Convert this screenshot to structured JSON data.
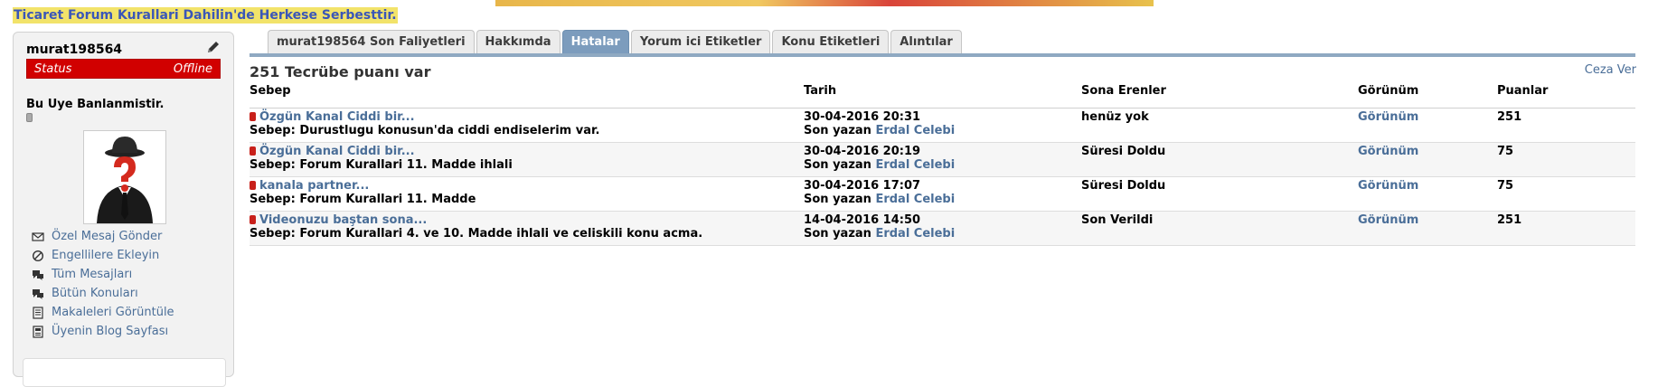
{
  "banner": {
    "notice": "Ticaret Forum Kurallari Dahilin'de Herkese Serbesttir."
  },
  "sidebar": {
    "username": "murat198564",
    "status_label": "Status",
    "status_value": "Offline",
    "banned_text": "Bu Uye Banlanmistir.",
    "links": [
      {
        "label": "Özel Mesaj Gönder",
        "icon": "envelope-icon"
      },
      {
        "label": "Engellilere Ekleyin",
        "icon": "block-icon"
      },
      {
        "label": "Tüm Mesajları",
        "icon": "chat-bubbles-icon"
      },
      {
        "label": "Bütün Konuları",
        "icon": "chat-bubbles-icon"
      },
      {
        "label": "Makaleleri Görüntüle",
        "icon": "article-icon"
      },
      {
        "label": "Üyenin Blog Sayfası",
        "icon": "blog-icon"
      }
    ]
  },
  "tabs": [
    {
      "label": "murat198564 Son Faliyetleri",
      "active": false
    },
    {
      "label": "Hakkımda",
      "active": false
    },
    {
      "label": "Hatalar",
      "active": true
    },
    {
      "label": "Yorum ici Etiketler",
      "active": false
    },
    {
      "label": "Konu Etiketleri",
      "active": false
    },
    {
      "label": "Alıntılar",
      "active": false
    }
  ],
  "content": {
    "title": "251 Tecrübe puanı var",
    "ceza_link": "Ceza Ver",
    "headers": {
      "sebep": "Sebep",
      "tarih": "Tarih",
      "sona": "Sona Erenler",
      "gorunum": "Görünüm",
      "puanlar": "Puanlar"
    },
    "rows": [
      {
        "topic": "Özgün Kanal Ciddi bir...",
        "reason": "Sebep: Durustlugu konusun'da ciddi endiselerim var.",
        "date": "30-04-2016 20:31",
        "by_label": "Son yazan",
        "by_user": "Erdal Celebi",
        "expiry": "henüz yok",
        "view": "Görünüm",
        "points": "251"
      },
      {
        "topic": "Özgün Kanal Ciddi bir...",
        "reason": "Sebep: Forum Kurallari 11. Madde ihlali",
        "date": "30-04-2016 20:19",
        "by_label": "Son yazan",
        "by_user": "Erdal Celebi",
        "expiry": "Süresi Doldu",
        "view": "Görünüm",
        "points": "75"
      },
      {
        "topic": "kanala partner...",
        "reason": "Sebep: Forum Kurallari 11. Madde",
        "date": "30-04-2016 17:07",
        "by_label": "Son yazan",
        "by_user": "Erdal Celebi",
        "expiry": "Süresi Doldu",
        "view": "Görünüm",
        "points": "75"
      },
      {
        "topic": "Videonuzu baştan sona...",
        "reason": "Sebep: Forum Kurallari 4. ve 10. Madde ihlali ve celiskili konu acma.",
        "date": "14-04-2016 14:50",
        "by_label": "Son yazan",
        "by_user": "Erdal Celebi",
        "expiry": "Son Verildi",
        "view": "Görünüm",
        "points": "251"
      }
    ]
  }
}
